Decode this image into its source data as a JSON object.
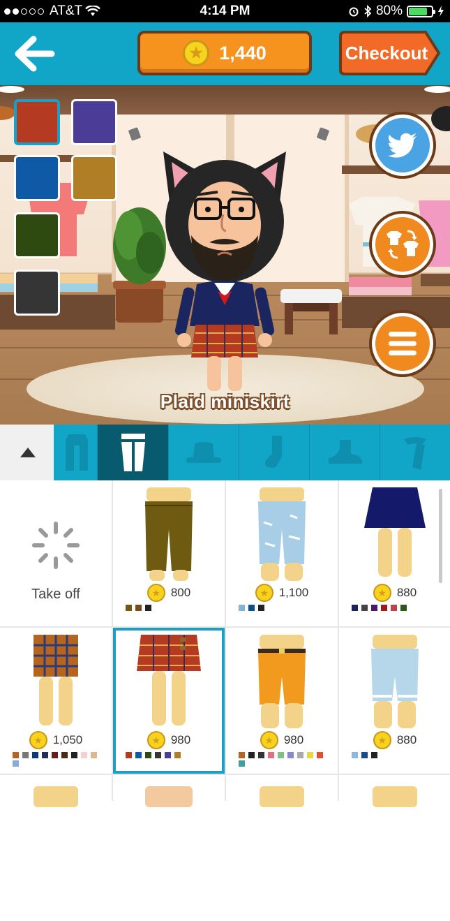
{
  "status_bar": {
    "carrier": "AT&T",
    "time": "4:14 PM",
    "battery": "80%",
    "battery_level": 0.8
  },
  "header": {
    "back_icon": "left-arrow-icon",
    "coins": "1,440",
    "checkout_label": "Checkout"
  },
  "scene": {
    "item_name": "Plaid miniskirt",
    "swatches": [
      {
        "color": "#b53a22",
        "selected": true
      },
      {
        "color": "#4b3d97",
        "selected": false
      },
      {
        "color": "#0f5aa6",
        "selected": false
      },
      {
        "color": "#b07e24",
        "selected": false
      },
      {
        "color": "#2f4a10",
        "selected": false
      },
      {
        "color": "#353535",
        "selected": false
      }
    ],
    "buttons": [
      "twitter-icon",
      "swap-outfit-icon",
      "menu-icon"
    ]
  },
  "tabs": [
    "collapse",
    "tops",
    "bottoms",
    "hats",
    "socks",
    "shoes",
    "accessories"
  ],
  "items": [
    {
      "kind": "takeoff",
      "label": "Take off"
    },
    {
      "price": "800",
      "colors": [
        "#6e5a10",
        "#7a4a1a",
        "#222222"
      ]
    },
    {
      "price": "1,100",
      "colors": [
        "#7fb3d8",
        "#0d4f8a",
        "#222222"
      ]
    },
    {
      "price": "880",
      "colors": [
        "#1a2260",
        "#444444",
        "#4a1a6a",
        "#a01a1a",
        "#c04050",
        "#2a5a1a"
      ]
    },
    {
      "price": "1,050",
      "colors": [
        "#b5651d",
        "#777777",
        "#0d3a7a",
        "#222c55",
        "#6a1a1a",
        "#4a2a10",
        "#222222",
        "#f5d0d0",
        "#d9b88a",
        "#8aa8d8"
      ]
    },
    {
      "price": "980",
      "colors": [
        "#b53a22",
        "#0f5aa6",
        "#2f4a10",
        "#353535",
        "#4b3d97",
        "#b07e24"
      ]
    },
    {
      "price": "980",
      "colors": [
        "#b5651d",
        "#222222",
        "#333333",
        "#e07080",
        "#80c080",
        "#8888cc",
        "#aaaaaa",
        "#e8d840",
        "#e05030",
        "#40a0a0"
      ]
    },
    {
      "price": "880",
      "colors": [
        "#8ab8e0",
        "#1a4a8a",
        "#222222"
      ]
    }
  ]
}
